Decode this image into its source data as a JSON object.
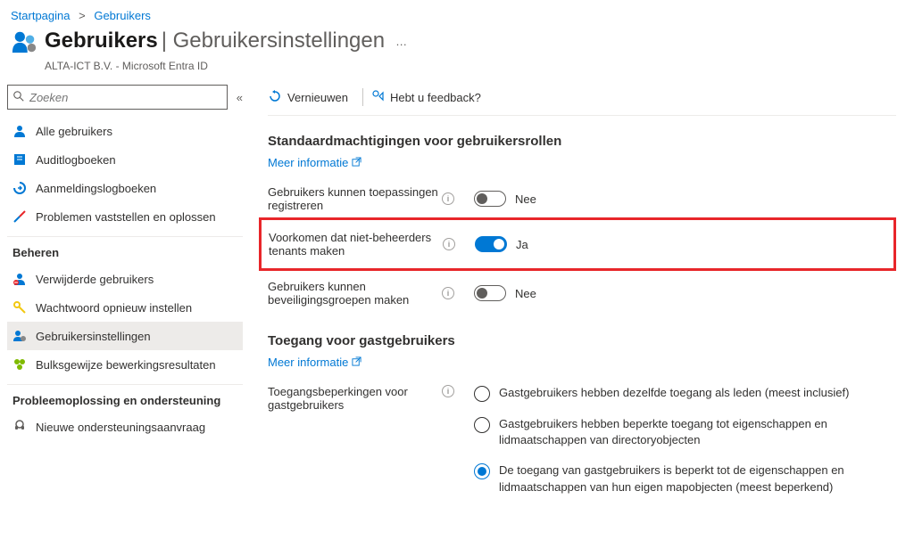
{
  "breadcrumb": {
    "home": "Startpagina",
    "users": "Gebruikers"
  },
  "header": {
    "title": "Gebruikers",
    "subtitle": "Gebruikersinstellingen",
    "org": "ALTA-ICT B.V. - Microsoft Entra ID"
  },
  "search": {
    "placeholder": "Zoeken"
  },
  "nav": {
    "all_users": "Alle gebruikers",
    "audit_logs": "Auditlogboeken",
    "signin_logs": "Aanmeldingslogboeken",
    "diagnose": "Problemen vaststellen en oplossen",
    "section_manage": "Beheren",
    "deleted_users": "Verwijderde gebruikers",
    "password_reset": "Wachtwoord opnieuw instellen",
    "user_settings": "Gebruikersinstellingen",
    "bulk_results": "Bulksgewijze bewerkingsresultaten",
    "section_support": "Probleemoplossing en ondersteuning",
    "new_support": "Nieuwe ondersteuningsaanvraag"
  },
  "toolbar": {
    "refresh": "Vernieuwen",
    "feedback": "Hebt u feedback?"
  },
  "sections": {
    "default_perms": {
      "title": "Standaardmachtigingen voor gebruikersrollen",
      "more_info": "Meer informatie",
      "register_apps": "Gebruikers kunnen toepassingen registreren",
      "register_apps_state": "Nee",
      "prevent_tenants": "Voorkomen dat niet-beheerders tenants maken",
      "prevent_tenants_state": "Ja",
      "sec_groups": "Gebruikers kunnen beveiligingsgroepen maken",
      "sec_groups_state": "Nee"
    },
    "guest": {
      "title": "Toegang voor gastgebruikers",
      "more_info": "Meer informatie",
      "restrictions_label": "Toegangsbeperkingen voor gastgebruikers",
      "opt1": "Gastgebruikers hebben dezelfde toegang als leden (meest inclusief)",
      "opt2": "Gastgebruikers hebben beperkte toegang tot eigenschappen en lidmaatschappen van directoryobjecten",
      "opt3": "De toegang van gastgebruikers is beperkt tot de eigenschappen en lidmaatschappen van hun eigen mapobjecten (meest beperkend)"
    }
  }
}
